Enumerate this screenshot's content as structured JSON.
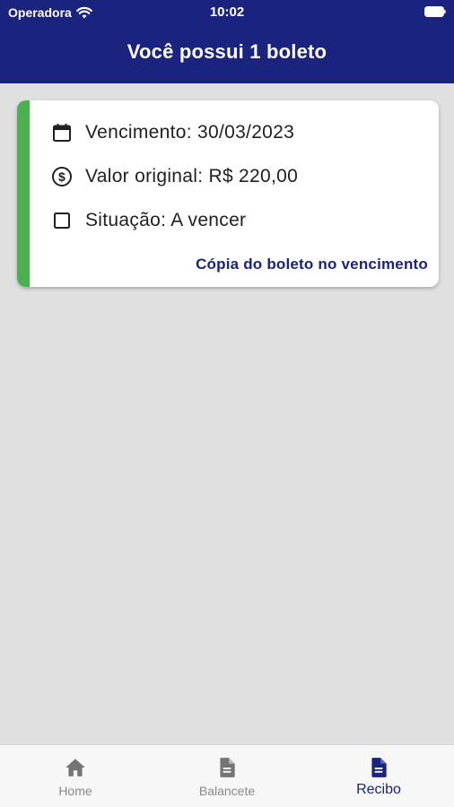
{
  "status_bar": {
    "carrier": "Operadora",
    "time": "10:02"
  },
  "header": {
    "title": "Você possui 1 boleto"
  },
  "boleto": {
    "due_date": "Vencimento: 30/03/2023",
    "original_value": "Valor original: R$ 220,00",
    "status": "Situação: A vencer",
    "copy_link": "Cópia do boleto no vencimento",
    "accent_color": "#4caf50"
  },
  "tabbar": {
    "active": "Recibo",
    "tabs": [
      {
        "label": "Home",
        "icon": "home-icon"
      },
      {
        "label": "Balancete",
        "icon": "document-icon"
      },
      {
        "label": "Recibo",
        "icon": "document-icon"
      }
    ]
  },
  "colors": {
    "primary": "#1a237e",
    "background": "#e0e0e0",
    "inactive_tab": "#8a8a8a"
  }
}
